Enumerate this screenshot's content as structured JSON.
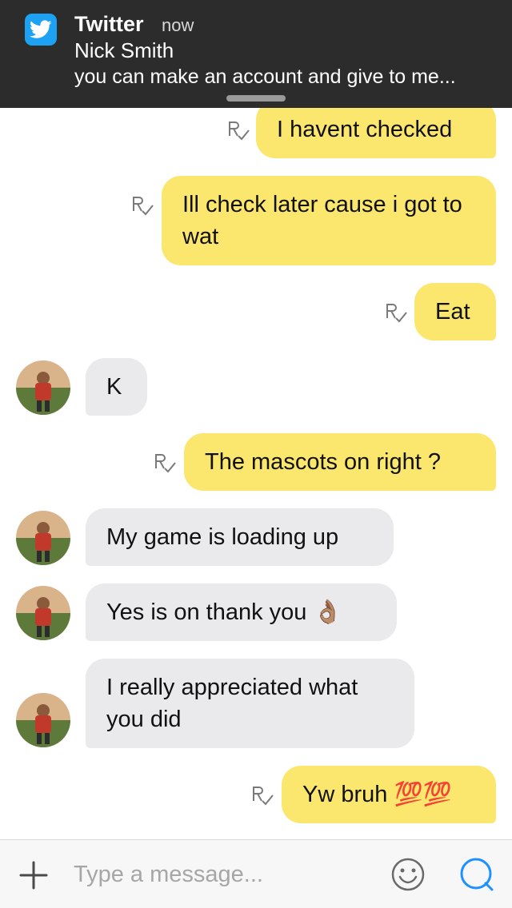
{
  "notification": {
    "app_name": "Twitter",
    "time": "now",
    "sender": "Nick Smith",
    "body": "you can make an account and give to me..."
  },
  "messages": [
    {
      "direction": "outgoing",
      "text": "I havent checked",
      "receipt_icon": "read-receipt-icon"
    },
    {
      "direction": "outgoing",
      "text": "Ill check later cause i got to wat",
      "receipt_icon": "read-receipt-icon"
    },
    {
      "direction": "outgoing",
      "text": "Eat",
      "receipt_icon": "read-receipt-icon"
    },
    {
      "direction": "incoming",
      "text": "K",
      "avatar": "avatar"
    },
    {
      "direction": "outgoing",
      "text": "The mascots on right ?",
      "receipt_icon": "read-receipt-icon"
    },
    {
      "direction": "incoming",
      "text": "My game is loading up",
      "avatar": "avatar"
    },
    {
      "direction": "incoming",
      "text": "Yes is on thank you 👌🏽",
      "avatar": "avatar"
    },
    {
      "direction": "incoming",
      "text": "I really appreciated what you did",
      "avatar": "avatar"
    },
    {
      "direction": "outgoing",
      "text": "Yw bruh 💯💯",
      "receipt_icon": "read-receipt-icon"
    }
  ],
  "composer": {
    "placeholder": "Type a message...",
    "value": ""
  },
  "colors": {
    "outgoing_bubble": "#fbe66e",
    "incoming_bubble": "#eaeaec",
    "accent": "#1e90ff",
    "twitter_blue": "#1da1f2"
  }
}
